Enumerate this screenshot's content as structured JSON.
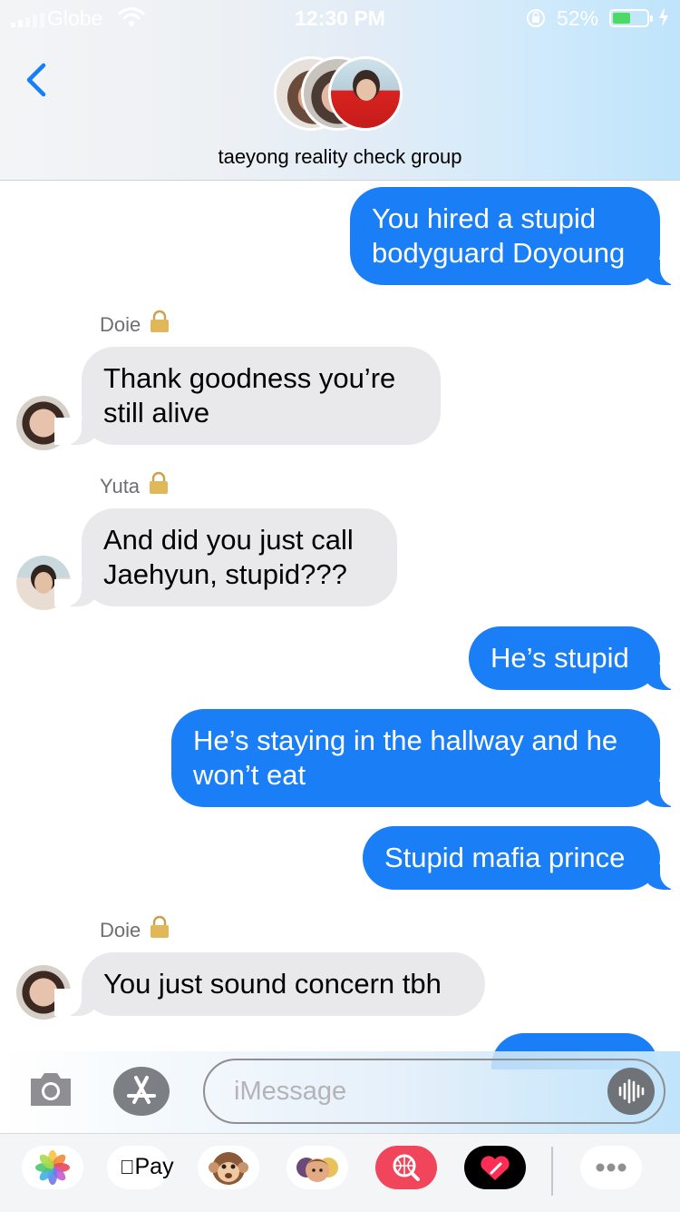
{
  "status_bar": {
    "carrier": "Globe",
    "time": "12:30 PM",
    "battery_percent": "52%",
    "battery_level": 0.52,
    "icons": [
      "signal-icon",
      "wifi-icon",
      "rotation-lock-icon",
      "battery-icon",
      "charging-bolt-icon"
    ]
  },
  "header": {
    "back_icon": "chevron-left-icon",
    "group_name": "taeyong reality check group",
    "avatar_count": 3
  },
  "messages": [
    {
      "direction": "outgoing",
      "lines": [
        "You hired a stupid",
        "bodyguard Doyoung"
      ]
    },
    {
      "direction": "incoming",
      "sender": "Doie",
      "lines": [
        "Thank goodness you’re",
        "still alive"
      ]
    },
    {
      "direction": "incoming",
      "sender": "Yuta",
      "lines": [
        "And did you just call",
        "Jaehyun, stupid???"
      ]
    },
    {
      "direction": "outgoing",
      "lines": [
        "He’s stupid"
      ]
    },
    {
      "direction": "outgoing",
      "lines": [
        "He’s staying in the hallway and he",
        "won’t eat"
      ]
    },
    {
      "direction": "outgoing",
      "lines": [
        "Stupid mafia prince"
      ]
    },
    {
      "direction": "incoming",
      "sender": "Doie",
      "lines": [
        "You just sound concern tbh"
      ]
    }
  ],
  "input_bar": {
    "placeholder": "iMessage",
    "icons": [
      "camera-icon",
      "app-store-icon",
      "audio-waveform-icon"
    ]
  },
  "app_drawer": {
    "apple_pay_label": "Pay",
    "apps": [
      "photos-app-icon",
      "apple-pay-icon",
      "animoji-icon",
      "memoji-icon",
      "web-search-icon",
      "digital-touch-icon",
      "more-apps-icon"
    ]
  },
  "colors": {
    "outgoing_bubble": "#1a7ef7",
    "incoming_bubble": "#e9e9eb",
    "ios_blue": "#147efb",
    "battery_green": "#4cd964"
  }
}
